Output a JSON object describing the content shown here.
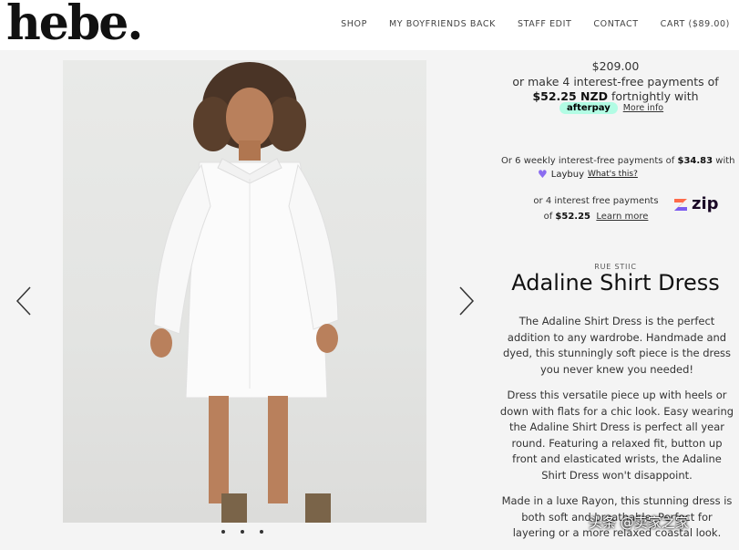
{
  "header": {
    "logo": "hebe.",
    "nav": [
      "SHOP",
      "MY BOYFRIENDS BACK",
      "STAFF EDIT",
      "CONTACT",
      "CART ($89.00)"
    ]
  },
  "gallery": {
    "slide_count": 3
  },
  "product": {
    "price": "$209.00",
    "afterpay": {
      "line1": "or make 4 interest-free payments of",
      "amount": "$52.25 NZD",
      "suffix": "fortnightly with",
      "badge": "afterpay",
      "more": "More info"
    },
    "laybuy": {
      "prefix": "Or 6 weekly interest-free payments of",
      "amount": "$34.83",
      "suffix": "with",
      "brand": "Laybuy",
      "link": "What's this?"
    },
    "zip": {
      "line1": "or 4 interest free payments",
      "prefix": "of",
      "amount": "$52.25",
      "link": "Learn more",
      "logo": "zip"
    },
    "brand": "RUE STIIC",
    "title": "Adaline Shirt Dress",
    "description": [
      "The Adaline Shirt Dress is the perfect addition to any wardrobe. Handmade and dyed, this stunningly soft piece is the dress you never knew you needed!",
      "Dress this versatile piece up with heels or down with flats for a chic look. Easy wearing the Adaline Shirt Dress is perfect all year round. Featuring a relaxed fit, button up front and elasticated wrists, the Adaline Shirt Dress won't disappoint.",
      "Made in a luxe Rayon, this stunning dress is both soft and breathable. Perfect for layering or a more relaxed coastal look."
    ]
  },
  "watermark": "头条 @卖家之家",
  "colors": {
    "afterpay_mint": "#b2fce4",
    "laybuy_purple": "#8a6cf0",
    "zip_dark": "#1a0826"
  }
}
